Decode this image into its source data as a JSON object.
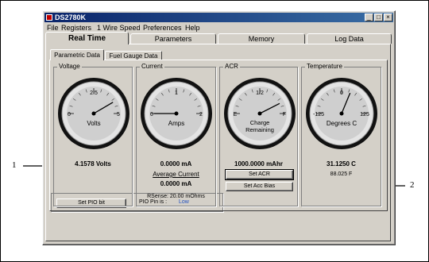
{
  "window": {
    "title": "DS2780K",
    "controls": {
      "minimize": "_",
      "maximize": "□",
      "close": "×"
    }
  },
  "menu": [
    "File",
    "Registers",
    "1 Wire Speed",
    "Preferences",
    "Help"
  ],
  "main_tabs": [
    "Real Time",
    "Parameters",
    "Memory",
    "Log Data"
  ],
  "sub_tabs": [
    "Parametric Data",
    "Fuel Gauge Data"
  ],
  "voltage": {
    "label": "Voltage",
    "gauge": {
      "unit": "Volts",
      "min_label": "0",
      "mid_label": "2.5",
      "max_label": "5",
      "min": 0,
      "max": 5,
      "value": 4.1578
    },
    "reading": "4.1578 Volts"
  },
  "current": {
    "label": "Current",
    "gauge": {
      "unit": "Amps",
      "min_label": "0",
      "mid_label": "1",
      "max_label": "2",
      "min": 0,
      "max": 2,
      "value": 0
    },
    "reading": "0.0000 mA",
    "average_label": "Average Current",
    "average_reading": "0.0000 mA",
    "rsense": "RSense: 20.00 mOhms"
  },
  "acr": {
    "label": "ACR",
    "gauge": {
      "unit": "Charge",
      "unit2": "Remaining",
      "min_label": "E",
      "mid_label": "1/2",
      "max_label": "F",
      "min": 0,
      "max": 1,
      "value": 0.85
    },
    "reading": "1000.0000 mAhr",
    "set_acr_button": "Set ACR",
    "set_acc_bias_button": "Set Acc Bias"
  },
  "temperature": {
    "label": "Temperature",
    "gauge": {
      "unit": "Degrees C",
      "min_label": "-125",
      "mid_label": "0",
      "max_label": "125",
      "min": -125,
      "max": 125,
      "value": 31.125
    },
    "reading": "31.1250 C",
    "reading_f": "88.025 F"
  },
  "pio": {
    "button": "Set PIO bit",
    "label": "PIO Pin is :",
    "value": "Low",
    "value_color": "#1f4fbf"
  },
  "callouts": {
    "one": "1",
    "two": "2"
  }
}
